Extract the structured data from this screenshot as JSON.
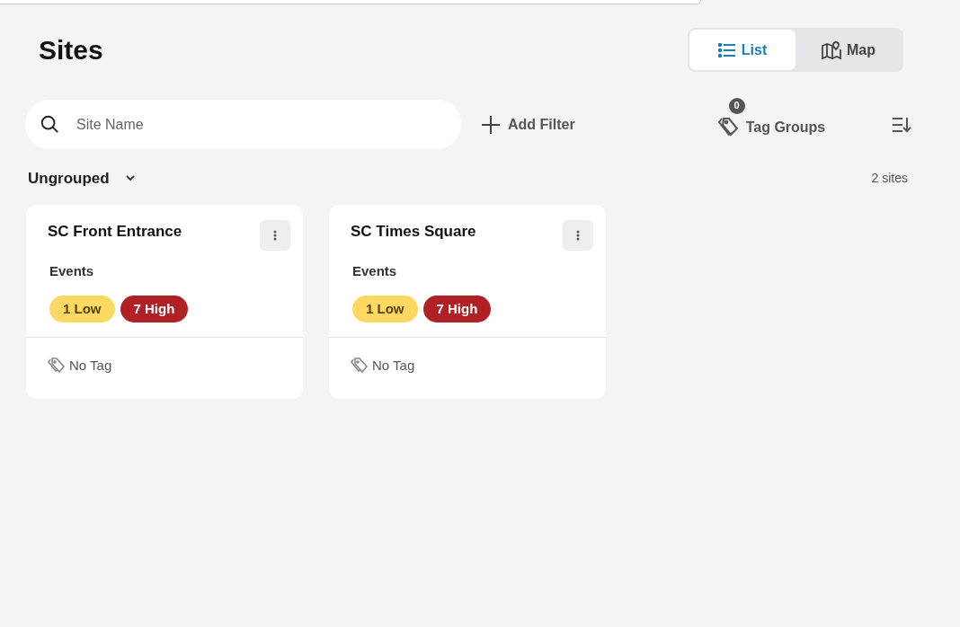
{
  "page": {
    "title": "Sites"
  },
  "view_toggle": [
    {
      "label": "List",
      "kind": "list",
      "selected": true
    },
    {
      "label": "Map",
      "kind": "map",
      "selected": false
    }
  ],
  "search": {
    "placeholder": "Site Name"
  },
  "add_filter": {
    "label": "Add Filter"
  },
  "tag_groups": {
    "label": "Tag Groups",
    "count": "0"
  },
  "group": {
    "label": "Ungrouped",
    "expanded": true,
    "count": "2 sites"
  },
  "sites": [
    {
      "name": "SC Front Entrance",
      "events_label": "Events",
      "events": [
        {
          "label": "1 Low",
          "kind": "low"
        },
        {
          "label": "7 High",
          "kind": "high"
        }
      ],
      "tag": "No Tag"
    },
    {
      "name": "SC Times Square",
      "events_label": "Events",
      "events": [
        {
          "label": "1 Low",
          "kind": "low"
        },
        {
          "label": "7 High",
          "kind": "high"
        }
      ],
      "tag": "No Tag"
    }
  ]
}
